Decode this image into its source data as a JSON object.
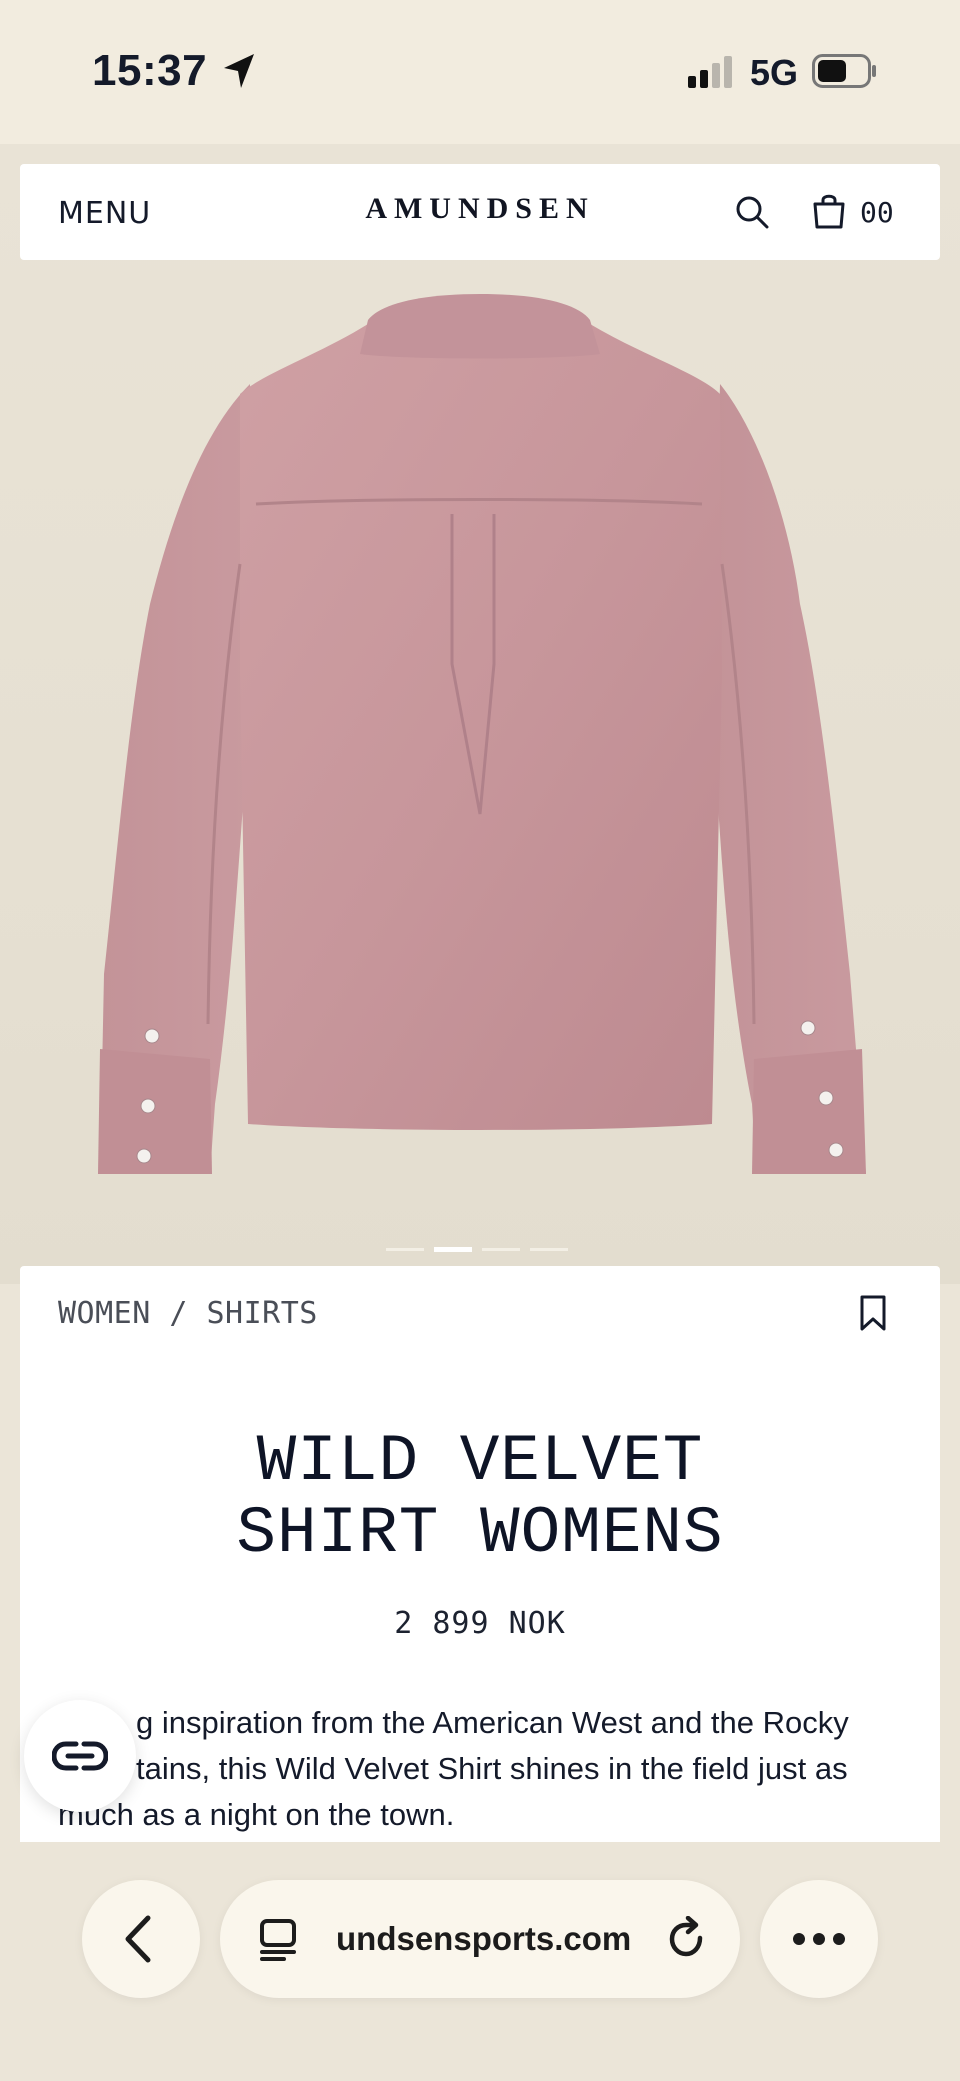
{
  "status_bar": {
    "time": "15:37",
    "network": "5G"
  },
  "header": {
    "menu_label": "MENU",
    "brand": "AMUNDSEN",
    "cart_count": "00",
    "icons": [
      "search-icon",
      "cart-icon"
    ]
  },
  "carousel": {
    "slide_count": 4,
    "active_index": 1
  },
  "product": {
    "breadcrumb": "WOMEN / SHIRTS",
    "title_line1": "WILD VELVET",
    "title_line2": "SHIRT WOMENS",
    "price": "2 899 NOK",
    "description": "g inspiration from the American West and the Rocky tains, this Wild Velvet Shirt shines in the field just as much as a night on the town.",
    "description_line1": "g inspiration from the American West and the Rocky",
    "description_line2": "tains, this Wild Velvet Shirt shines in the field just as",
    "description_line3": "much as a night on the town."
  },
  "browser": {
    "url": "undsensports.com",
    "icons": [
      "back-icon",
      "tabs-icon",
      "reload-icon",
      "more-icon"
    ]
  },
  "colors": {
    "background": "#ebe5d8",
    "shirt": "#c9979c",
    "text_dark": "#141a2a"
  }
}
